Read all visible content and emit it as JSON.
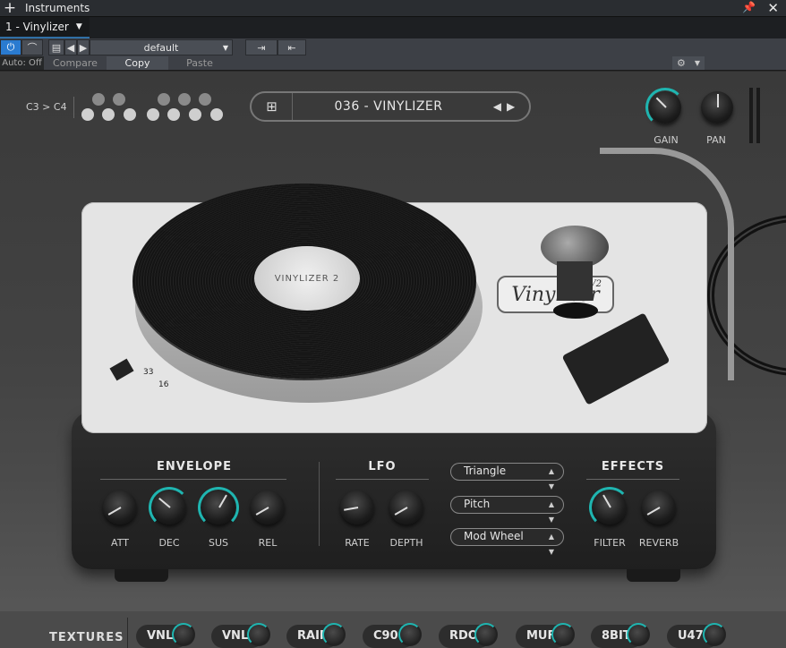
{
  "window": {
    "title": "Instruments",
    "tab": "1 - Vinylizer"
  },
  "toolbar": {
    "preset": "default",
    "auto": "Auto: Off",
    "compare": "Compare",
    "copy": "Copy",
    "paste": "Paste"
  },
  "plugin": {
    "octave": "C3 > C4",
    "preset_name": "036 - VINYLIZER",
    "logo": "Vinylizer",
    "logo_version": "V2",
    "speed_33": "33",
    "speed_16": "16",
    "label_text": "VINYLIZER 2",
    "master": {
      "gain": "GAIN",
      "pan": "PAN"
    },
    "envelope": {
      "title": "ENVELOPE",
      "att": "ATT",
      "dec": "DEC",
      "sus": "SUS",
      "rel": "REL"
    },
    "lfo": {
      "title": "LFO",
      "rate": "RATE",
      "depth": "DEPTH",
      "shape": "Triangle",
      "target": "Pitch",
      "source": "Mod Wheel"
    },
    "effects": {
      "title": "EFFECTS",
      "filter": "FILTER",
      "reverb": "REVERB"
    },
    "textures": {
      "label": "TEXTURES",
      "items": [
        "VNL",
        "VNL",
        "RAIN",
        "C90",
        "RDO",
        "MUFF",
        "8BIT",
        "U47"
      ]
    }
  },
  "colors": {
    "accent": "#1fb5b0",
    "power": "#2a7bd0"
  }
}
